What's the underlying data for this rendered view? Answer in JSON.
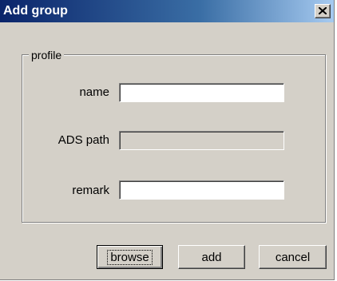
{
  "window": {
    "title": "Add group",
    "close_label": "close"
  },
  "groupbox": {
    "label": "profile"
  },
  "fields": {
    "name": {
      "label": "name",
      "value": ""
    },
    "ads_path": {
      "label": "ADS path",
      "value": ""
    },
    "remark": {
      "label": "remark",
      "value": ""
    }
  },
  "buttons": {
    "browse": "browse",
    "add": "add",
    "cancel": "cancel"
  },
  "icons": {
    "close": "close-icon"
  },
  "colors": {
    "title_bar_start": "#0a246a",
    "title_bar_end": "#a6caf0",
    "dialog_face": "#d4d0c8"
  }
}
